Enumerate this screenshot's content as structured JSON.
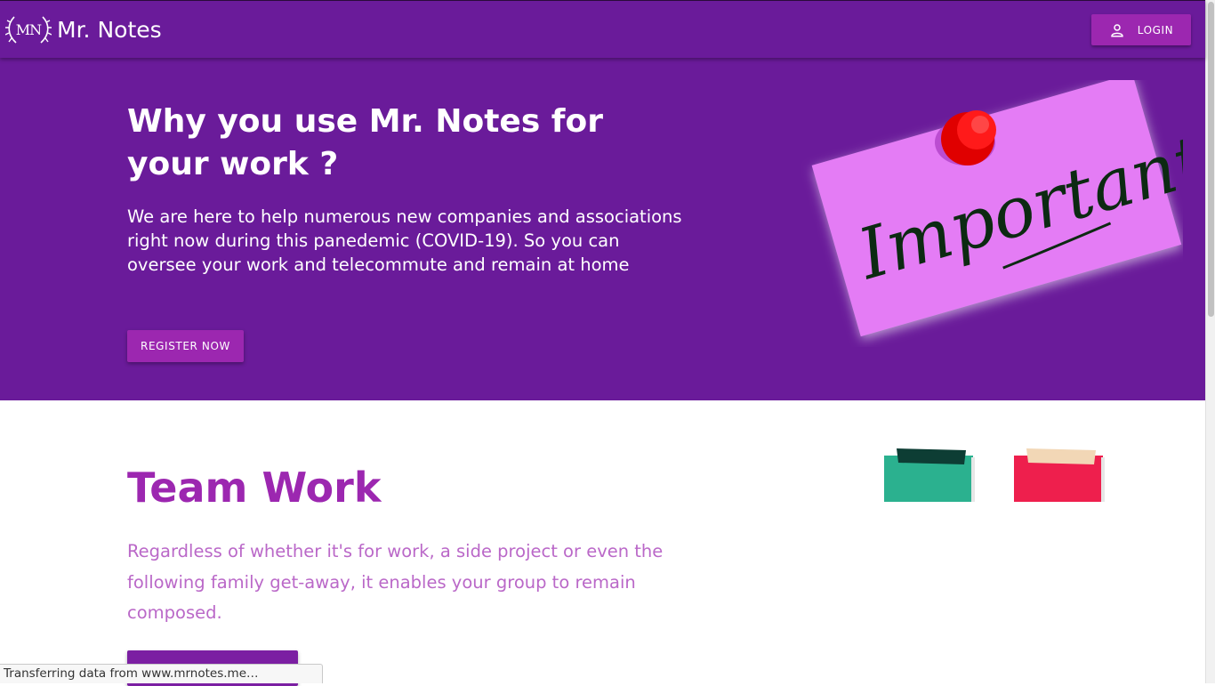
{
  "header": {
    "logo_text": "MN",
    "brand_name": "Mr. Notes",
    "login_label": "LOGIN"
  },
  "hero": {
    "title": "Why you use Mr. Notes for your work ?",
    "description": "We are here to help numerous new companies and associations right now during this panedemic (COVID-19). So you can oversee your work and telecommute and remain at home",
    "register_label": "REGISTER NOW",
    "note_text": "Important"
  },
  "team": {
    "title": "Team Work",
    "description": "Regardless of whether it's for work, a side project or even the following family get-away, it enables your group to remain composed."
  },
  "status": {
    "text": "Transferring data from www.mrnotes.me…"
  },
  "colors": {
    "primary": "#6a1b9a",
    "accent": "#9c27b0",
    "heading": "#9c27b0",
    "subtext": "#ba68c8",
    "note_pink": "#e47cf5",
    "pin_red": "#e00000"
  },
  "icons": {
    "login": "person-icon",
    "logo": "laurel-icon"
  }
}
